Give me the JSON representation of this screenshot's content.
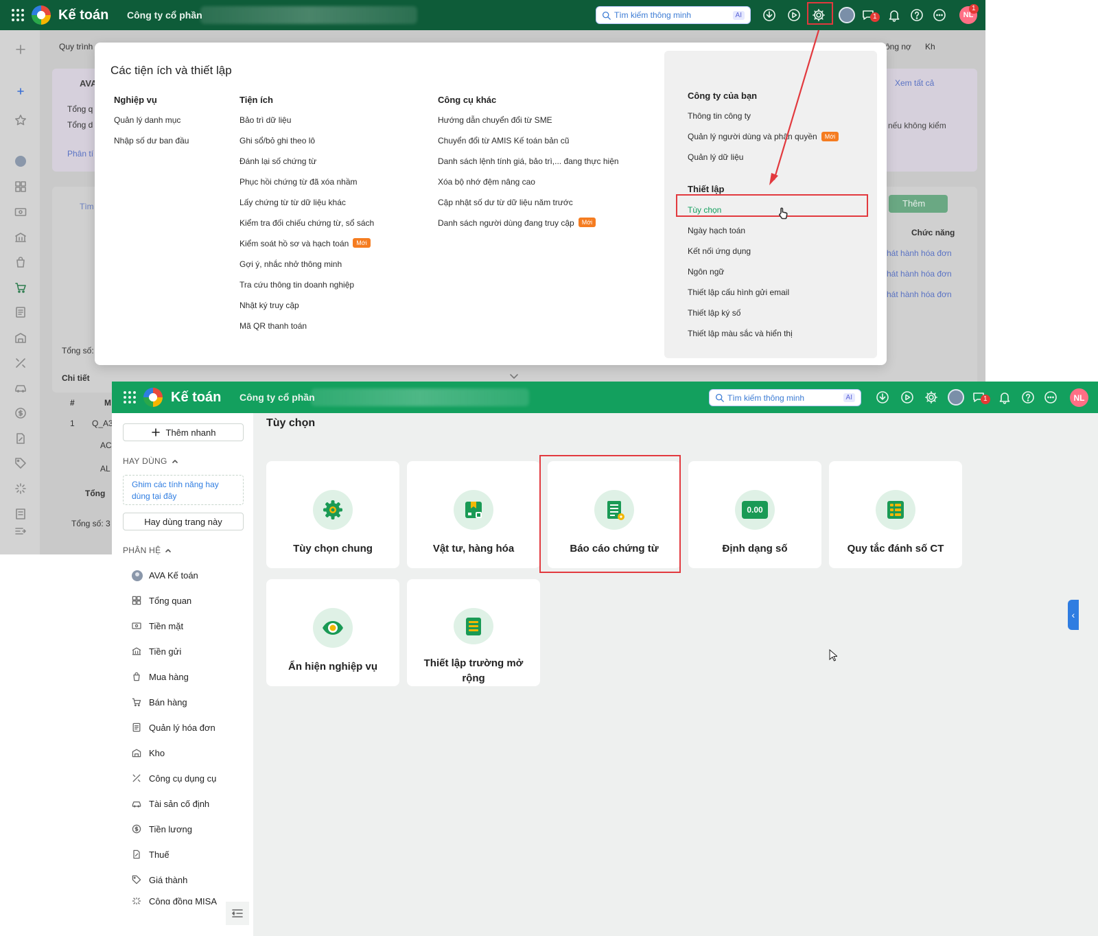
{
  "top": {
    "app_title": "Kế toán",
    "company": "Công ty cổ phần",
    "search_placeholder": "Tìm kiếm thông minh",
    "search_ai": "AI",
    "nl_initials": "NL",
    "nl_badge": "1",
    "chat_badge": "1",
    "background_tabs": [
      "Quy trình",
      "ông nợ",
      "Kh"
    ],
    "background": {
      "ava_label": "AVA",
      "tong_q": "Tổng q",
      "tong_d": "Tổng d",
      "phan_ti": "Phân tí",
      "xem_tat_ca": "Xem tất cả",
      "neu_khong_kiem": "nếu không kiểm",
      "tim": "Tìm",
      "them": "Thêm",
      "chuc_nang": "Chức năng",
      "phat_hanh": "hát hành hóa đơn",
      "tong_so": "Tổng số:",
      "chi_tiet": "Chi tiết",
      "hash": "#",
      "row1_no": "1",
      "row1_code": "Q_A3",
      "ac": "AC",
      "al": "AL",
      "tong": "Tổng",
      "tong_so2": "Tổng số: 3",
      "m": "M"
    },
    "modal": {
      "title": "Các tiện ích và thiết lập",
      "col1": {
        "head": "Nghiệp vụ",
        "items": [
          "Quản lý danh mục",
          "Nhập số dư ban đầu"
        ]
      },
      "col2": {
        "head": "Tiện ích",
        "items": [
          "Bảo trì dữ liệu",
          "Ghi sổ/bỏ ghi theo lô",
          "Đánh lại số chứng từ",
          "Phục hồi chứng từ đã xóa nhầm",
          "Lấy chứng từ từ dữ liệu khác",
          "Kiểm tra đối chiếu chứng từ, sổ sách",
          "Kiểm soát hồ sơ và hạch toán",
          "Gợi ý, nhắc nhở thông minh",
          "Tra cứu thông tin doanh nghiệp",
          "Nhật ký truy cập",
          "Mã QR thanh toán"
        ]
      },
      "col3": {
        "head": "Công cụ khác",
        "items": [
          "Hướng dẫn chuyển đổi từ SME",
          "Chuyển đổi từ AMIS Kế toán bản cũ",
          "Danh sách lệnh tính giá, bảo trì,... đang thực hiện",
          "Xóa bộ nhớ đệm nâng cao",
          "Cập nhật số dư từ dữ liệu năm trước",
          "Danh sách người dùng đang truy cập"
        ]
      },
      "new_badge": "Mới",
      "company_head": "Công ty của bạn",
      "company_items": [
        "Thông tin công ty",
        "Quản lý người dùng và phân quyền",
        "Quản lý dữ liệu"
      ],
      "settings_head": "Thiết lập",
      "settings_items": [
        "Tùy chọn",
        "Ngày hạch toán",
        "Kết nối ứng dụng",
        "Ngôn ngữ",
        "Thiết lập cấu hình gửi email",
        "Thiết lập ký số",
        "Thiết lập màu sắc và hiển thị"
      ]
    }
  },
  "bottom": {
    "app_title": "Kế toán",
    "company": "Công ty cổ phần",
    "search_placeholder": "Tìm kiếm thông minh",
    "search_ai": "AI",
    "nl_initials": "NL",
    "chat_badge": "1",
    "quick_add": "Thêm nhanh",
    "hay_dung": "HAY DÙNG",
    "pin_hint": "Ghim các tính năng hay dùng tại đây",
    "hay_dung_page": "Hay dùng trang này",
    "phan_he": "PHÂN HỆ",
    "nav_items": [
      {
        "label": "AVA Kế toán",
        "icon": "ava-icon"
      },
      {
        "label": "Tổng quan",
        "icon": "dashboard-icon"
      },
      {
        "label": "Tiền mặt",
        "icon": "cash-icon"
      },
      {
        "label": "Tiền gửi",
        "icon": "bank-icon"
      },
      {
        "label": "Mua hàng",
        "icon": "shopping-bag-icon"
      },
      {
        "label": "Bán hàng",
        "icon": "cart-icon"
      },
      {
        "label": "Quản lý hóa đơn",
        "icon": "invoice-icon"
      },
      {
        "label": "Kho",
        "icon": "warehouse-icon"
      },
      {
        "label": "Công cụ dụng cụ",
        "icon": "tools-icon"
      },
      {
        "label": "Tài sản cố định",
        "icon": "car-icon"
      },
      {
        "label": "Tiền lương",
        "icon": "salary-icon"
      },
      {
        "label": "Thuế",
        "icon": "tax-icon"
      },
      {
        "label": "Giá thành",
        "icon": "price-tag-icon"
      },
      {
        "label": "Cộng đồng MISA",
        "icon": "community-icon"
      }
    ],
    "page_title": "Tùy chọn",
    "cards": [
      "Tùy chọn chung",
      "Vật tư, hàng hóa",
      "Báo cáo chứng từ",
      "Định dạng số",
      "Quy tắc đánh số CT",
      "Ẩn hiện nghiệp vụ",
      "Thiết lập trường mở rộng"
    ],
    "number_format_icon_text": "0.00"
  },
  "colors": {
    "dark_green": "#0e5c39",
    "green": "#13a05e",
    "highlight_red": "#e2393e",
    "accent_orange": "#f57c20",
    "link_blue": "#2f7de1"
  }
}
